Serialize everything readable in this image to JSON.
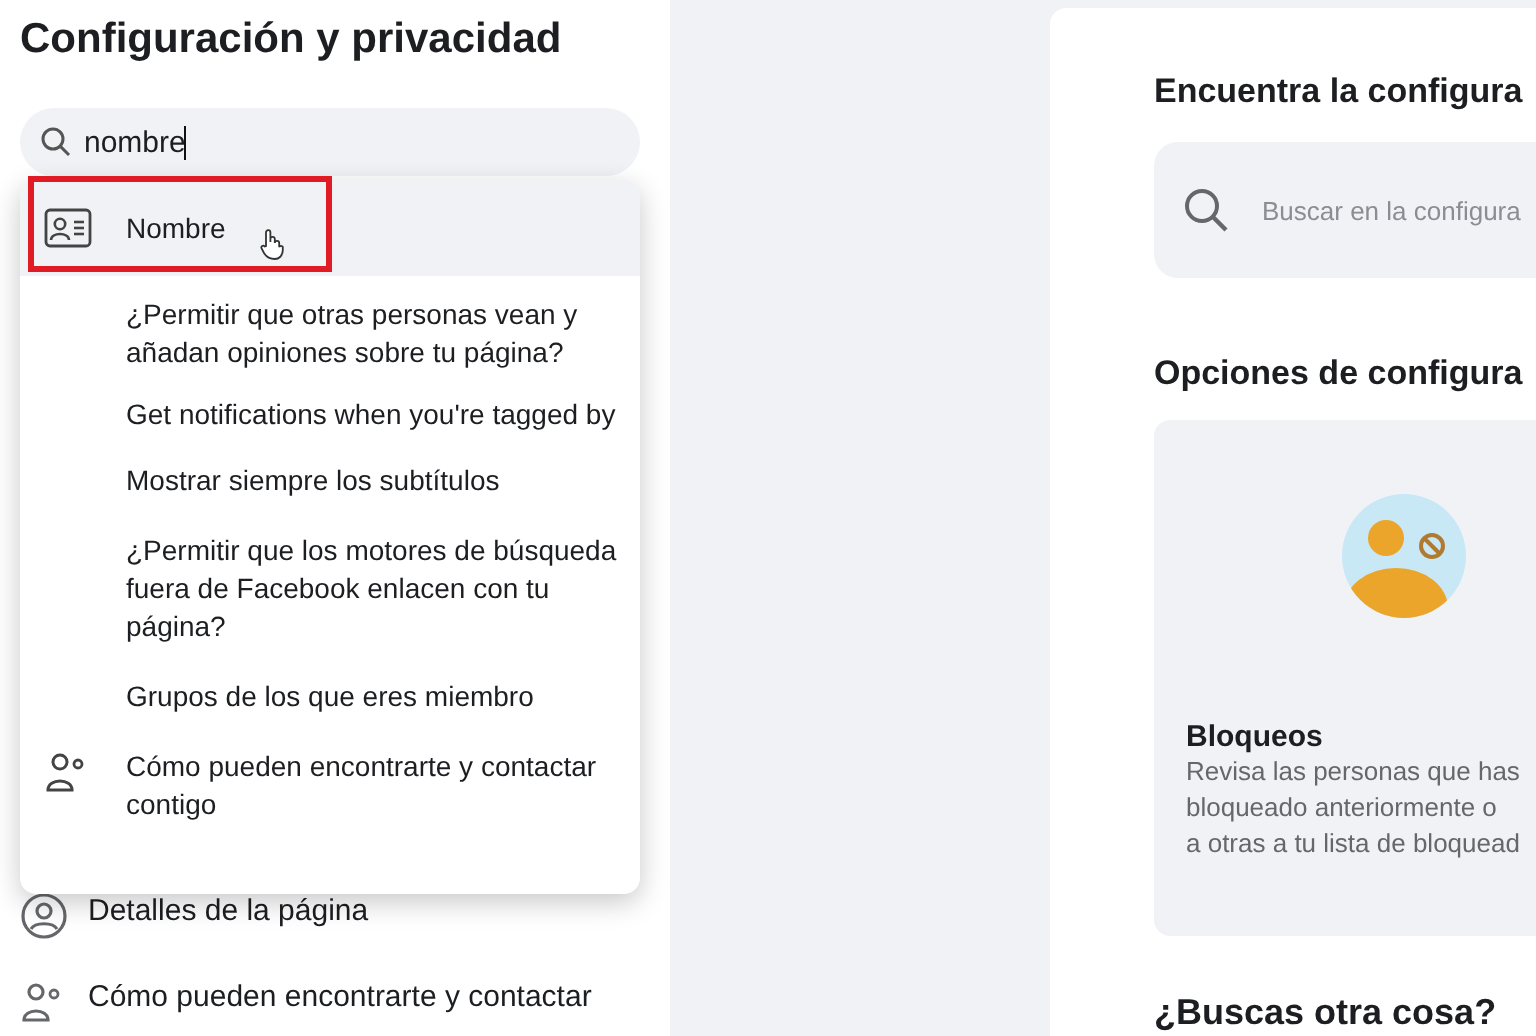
{
  "sidebar": {
    "title": "Configuración y privacidad",
    "search": {
      "value": "nombre"
    },
    "results": [
      {
        "kind": "id-card",
        "label": "Nombre",
        "selected": true,
        "outlined": true
      },
      {
        "kind": "plain",
        "label": "¿Permitir que otras personas vean y añadan opiniones sobre tu página?",
        "selected": false,
        "outlined": false
      },
      {
        "kind": "plain",
        "label": "Get notifications when you're tagged by",
        "selected": false,
        "outlined": false
      },
      {
        "kind": "plain",
        "label": "Mostrar siempre los subtítulos",
        "selected": false,
        "outlined": false
      },
      {
        "kind": "plain",
        "label": "¿Permitir que los motores de búsqueda fuera de Facebook enlacen con tu página?",
        "selected": false,
        "outlined": false
      },
      {
        "kind": "plain",
        "label": "Grupos de los que eres miembro",
        "selected": false,
        "outlined": false
      },
      {
        "kind": "people",
        "label": "Cómo pueden encontrarte y contactar contigo",
        "selected": false,
        "outlined": false
      }
    ],
    "items": [
      {
        "kind": "profile",
        "label": "Detalles de la página"
      },
      {
        "kind": "people",
        "label": "Cómo pueden encontrarte y contactar"
      }
    ]
  },
  "main": {
    "find_title": "Encuentra la configura",
    "search": {
      "placeholder": "Buscar en la configura"
    },
    "options_title": "Opciones de configura",
    "card": {
      "title": "Bloqueos",
      "description_lines": [
        "Revisa las personas que has",
        "bloqueado anteriormente o",
        "a otras a tu lista de bloquead"
      ]
    },
    "more_title": "¿Buscas otra cosa?"
  }
}
